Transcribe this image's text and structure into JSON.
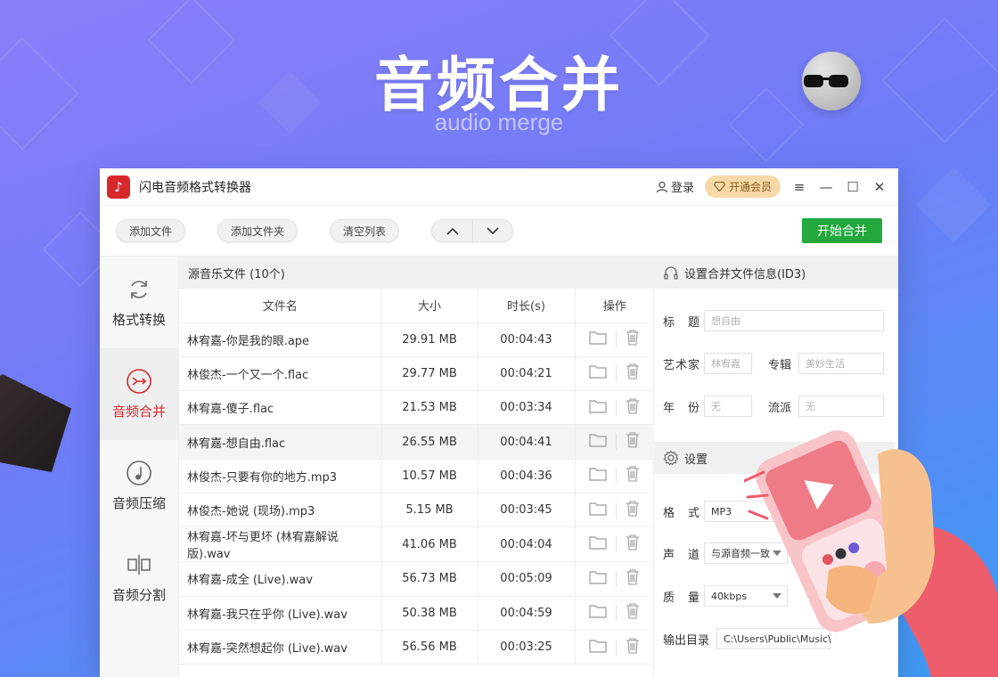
{
  "hero": {
    "title": "音频合并",
    "subtitle": "audio merge"
  },
  "window": {
    "app_title": "闪电音频格式转换器",
    "login_label": "登录",
    "vip_label": "开通会员",
    "menu_icon": "≡",
    "minimize_icon": "—",
    "maximize_icon": "☐",
    "close_icon": "✕"
  },
  "toolbar": {
    "add_file": "添加文件",
    "add_folder": "添加文件夹",
    "clear_list": "清空列表",
    "start_merge": "开始合并"
  },
  "nav": [
    {
      "label": "格式转换",
      "icon": "refresh-icon"
    },
    {
      "label": "音频合并",
      "icon": "merge-icon"
    },
    {
      "label": "音频压缩",
      "icon": "compress-icon"
    },
    {
      "label": "音频分割",
      "icon": "split-icon"
    }
  ],
  "files": {
    "header": "源音乐文件 (10个)",
    "columns": [
      "文件名",
      "大小",
      "时长(s)",
      "操作"
    ],
    "rows": [
      {
        "name": "林宥嘉-你是我的眼.ape",
        "size": "29.91 MB",
        "duration": "00:04:43"
      },
      {
        "name": "林俊杰-一个又一个.flac",
        "size": "29.77 MB",
        "duration": "00:04:21"
      },
      {
        "name": "林宥嘉-傻子.flac",
        "size": "21.53 MB",
        "duration": "00:03:34"
      },
      {
        "name": "林宥嘉-想自由.flac",
        "size": "26.55 MB",
        "duration": "00:04:41"
      },
      {
        "name": "林俊杰-只要有你的地方.mp3",
        "size": "10.57 MB",
        "duration": "00:04:36"
      },
      {
        "name": "林俊杰-她说 (现场).mp3",
        "size": "5.15 MB",
        "duration": "00:03:45"
      },
      {
        "name": "林宥嘉-坏与更坏 (林宥嘉解说版).wav",
        "size": "41.06 MB",
        "duration": "00:04:04"
      },
      {
        "name": "林宥嘉-成全 (Live).wav",
        "size": "56.73 MB",
        "duration": "00:05:09"
      },
      {
        "name": "林宥嘉-我只在乎你 (Live).wav",
        "size": "50.38 MB",
        "duration": "00:04:59"
      },
      {
        "name": "林宥嘉-突然想起你 (Live).wav",
        "size": "56.56 MB",
        "duration": "00:03:25"
      }
    ]
  },
  "id3": {
    "header": "设置合并文件信息(ID3)",
    "title_label": "标　题",
    "title_placeholder": "想自由",
    "artist_label": "艺术家",
    "artist_placeholder": "林宥嘉",
    "album_label": "专辑",
    "album_placeholder": "美妙生活",
    "year_label": "年　份",
    "year_placeholder": "无",
    "genre_label": "流派",
    "genre_placeholder": "无"
  },
  "settings": {
    "header": "设置",
    "format_label": "格　式",
    "format_value": "MP3",
    "channel_label": "声　道",
    "channel_value": "与源音频一致",
    "quality_label": "质　量",
    "quality_value": "40kbps",
    "output_label": "输出目录",
    "output_value": "C:\\Users\\Public\\Music\\"
  }
}
